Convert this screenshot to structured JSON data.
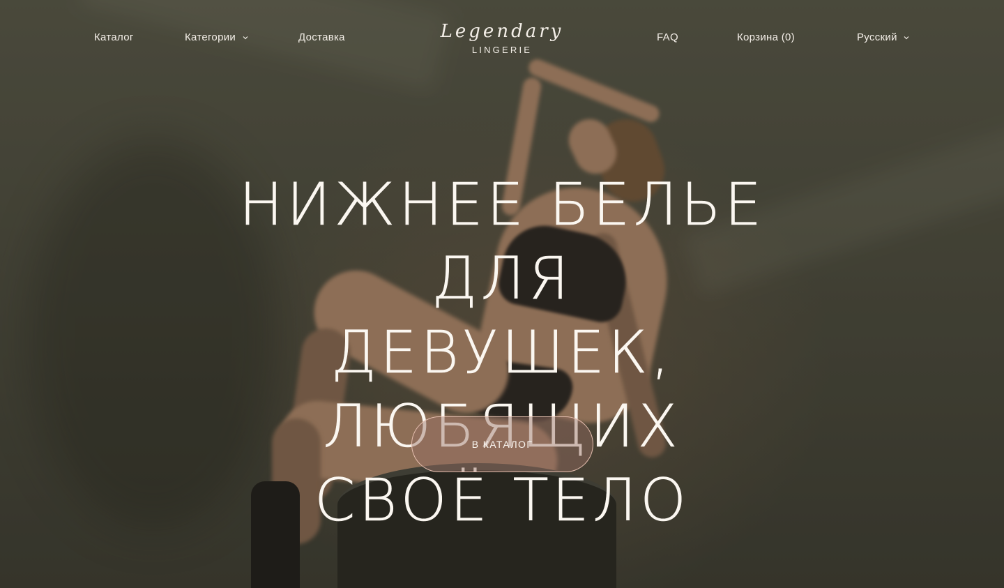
{
  "nav": {
    "catalog": "Каталог",
    "categories": "Категории",
    "delivery": "Доставка",
    "faq": "FAQ",
    "cart": "Корзина (0)",
    "language": "Русский",
    "dropdown_icon": "chevron-down-icon"
  },
  "logo": {
    "script": "Legendary",
    "sub": "LINGERIE"
  },
  "hero": {
    "headline_lines": [
      "Нижнее белье для",
      "девушек, любящих",
      "своё тело"
    ],
    "cta_label": "В КАТАЛОГ",
    "image": "woman in black lingerie sitting on a barrel"
  },
  "colors": {
    "text": "#f4efe8",
    "cta_border": "#e6bfb0",
    "background": "#4d4c3e"
  }
}
